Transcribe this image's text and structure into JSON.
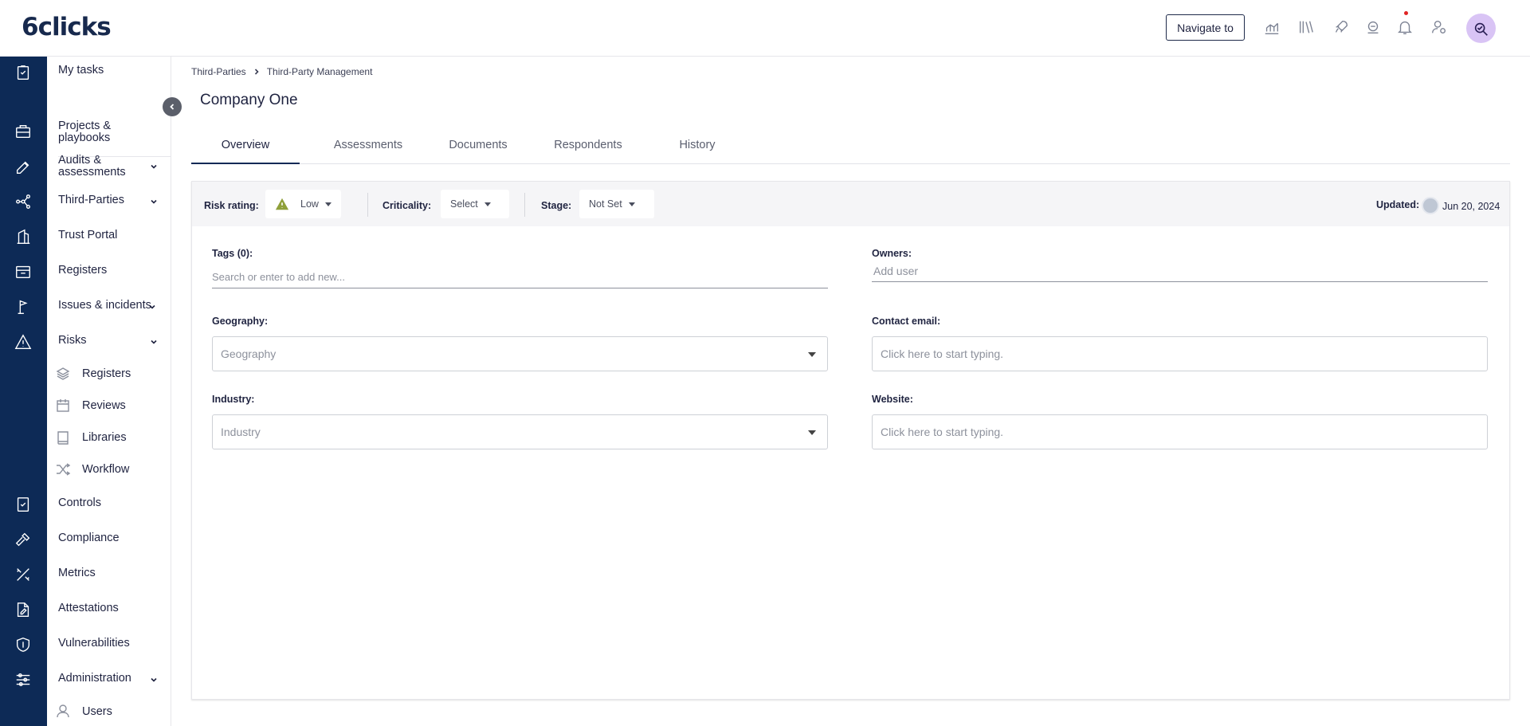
{
  "header": {
    "logo": "6clicks",
    "navigate_label": "Navigate to"
  },
  "sidebar": {
    "items": [
      {
        "label": "My tasks"
      },
      {
        "label": "Projects & playbooks"
      },
      {
        "label": "Audits & assessments"
      },
      {
        "label": "Third-Parties"
      },
      {
        "label": "Trust Portal"
      },
      {
        "label": "Registers"
      },
      {
        "label": "Issues & incidents"
      },
      {
        "label": "Risks"
      },
      {
        "label": "Controls"
      },
      {
        "label": "Compliance"
      },
      {
        "label": "Metrics"
      },
      {
        "label": "Attestations"
      },
      {
        "label": "Vulnerabilities"
      },
      {
        "label": "Administration"
      }
    ],
    "risk_sub": [
      {
        "label": "Registers"
      },
      {
        "label": "Reviews"
      },
      {
        "label": "Libraries"
      },
      {
        "label": "Workflow"
      }
    ],
    "admin_sub": [
      {
        "label": "Users"
      }
    ]
  },
  "breadcrumb": [
    "Third-Parties",
    "Third-Party Management"
  ],
  "page_title": "Company One",
  "tabs": [
    "Overview",
    "Assessments",
    "Documents",
    "Respondents",
    "History"
  ],
  "status": {
    "risk_label": "Risk rating:",
    "risk_value": "Low",
    "criticality_label": "Criticality:",
    "criticality_value": "Select",
    "stage_label": "Stage:",
    "stage_value": "Not Set",
    "updated_label": "Updated:",
    "updated_date": "Jun 20, 2024"
  },
  "form": {
    "tags_label": "Tags (0):",
    "tags_placeholder": "Search or enter to add new...",
    "owners_label": "Owners:",
    "owners_placeholder": "Add user",
    "geography_label": "Geography:",
    "geography_placeholder": "Geography",
    "contact_label": "Contact email:",
    "contact_placeholder": "Click here to start typing.",
    "industry_label": "Industry:",
    "industry_placeholder": "Industry",
    "website_label": "Website:",
    "website_placeholder": "Click here to start typing."
  },
  "colors": {
    "rail": "#0d2a56",
    "avatar": "#d9c4f5",
    "warning": "#8fa03a"
  }
}
